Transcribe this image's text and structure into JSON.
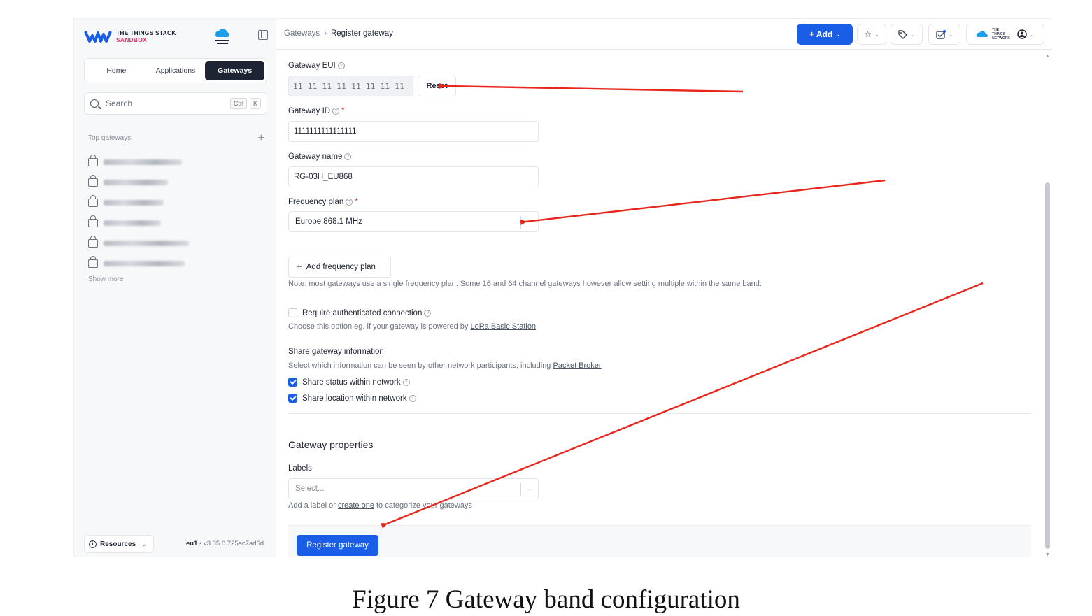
{
  "brand": {
    "line1": "THE THINGS STACK",
    "line2": "SANDBOX",
    "ttn_logo_text": "THE THINGS NETWORK"
  },
  "nav": {
    "tabs": [
      "Home",
      "Applications",
      "Gateways"
    ],
    "active": "Gateways"
  },
  "search": {
    "placeholder": "Search",
    "kbd1": "Ctrl",
    "kbd2": "K"
  },
  "top_gateways": {
    "label": "Top gateways",
    "add_symbol": "+",
    "show_more": "Show more"
  },
  "footer": {
    "resources_label": "Resources",
    "region": "eu1",
    "version": "• v3.35.0.725ac7ad6d"
  },
  "header": {
    "breadcrumb": [
      "Gateways",
      "Register gateway"
    ],
    "add_label": "+ Add",
    "account_text": "THE THINGS NETWORK"
  },
  "form": {
    "eui_label": "Gateway EUI",
    "eui_value": "11 11 11 11 11 11 11 11",
    "reset_label": "Reset",
    "id_label": "Gateway ID",
    "id_value": "1111111111111111",
    "name_label": "Gateway name",
    "name_value": "RG-03H_EU868",
    "freq_label": "Frequency plan",
    "freq_value": "Europe 868.1 MHz",
    "add_freq_label": "Add frequency plan",
    "freq_note": "Note: most gateways use a single frequency plan. Some 16 and 64 channel gateways however allow setting multiple within the same band.",
    "auth_label": "Require authenticated connection",
    "auth_note_prefix": "Choose this option eg. if your gateway is powered by",
    "auth_note_link": "LoRa Basic Station",
    "share_title": "Share gateway information",
    "share_note_prefix": "Select which information can be seen by other network participants, including",
    "share_note_link": "Packet Broker",
    "share_status_label": "Share status within network",
    "share_location_label": "Share location within network",
    "props_title": "Gateway properties",
    "labels_label": "Labels",
    "labels_placeholder": "Select...",
    "labels_note_prefix": "Add a label or",
    "labels_note_link": "create one",
    "labels_note_suffix": "to categorize your gateways",
    "register_label": "Register gateway"
  },
  "caption": "Figure 7 Gateway band configuration",
  "colors": {
    "primary": "#1a5ee8",
    "dark": "#1e2433",
    "brand_pink": "#e8326e",
    "annotation": "#e8261c"
  }
}
